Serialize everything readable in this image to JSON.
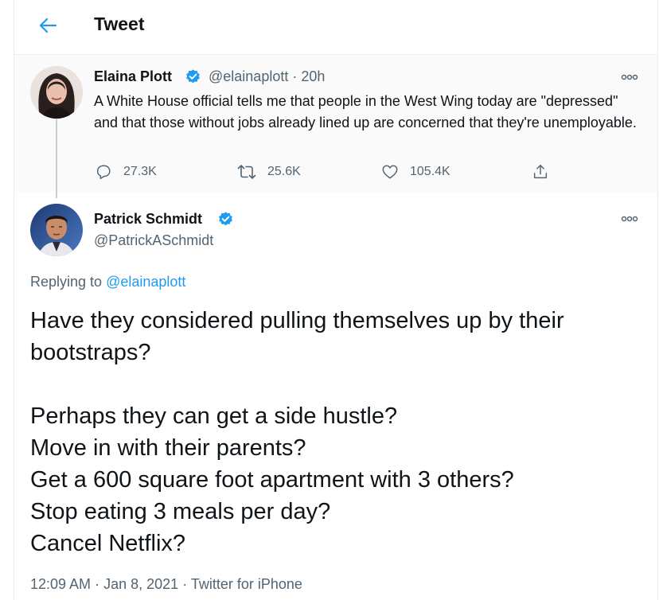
{
  "header": {
    "title": "Tweet"
  },
  "parent_tweet": {
    "name": "Elaina Plott",
    "handle": "@elainaplott",
    "time_sep": "·",
    "time": "20h",
    "text": "A White House official tells me that people in the West Wing today are \"depressed\" and that those without jobs already lined up are concerned that they're unemployable.",
    "actions": {
      "replies": "27.3K",
      "retweets": "25.6K",
      "likes": "105.4K"
    }
  },
  "main_tweet": {
    "name": "Patrick Schmidt",
    "handle": "@PatrickASchmidt",
    "replying_prefix": "Replying to",
    "replying_handle": "@elainaplott",
    "text": "Have they considered pulling themselves up by their\nbootstraps?\n\nPerhaps they can get a side hustle?\nMove in with their parents?\nGet a 600 square foot apartment with 3 others?\nStop eating 3 meals per day?\nCancel Netflix?",
    "time": "12:09 AM",
    "sep1": "·",
    "date": "Jan 8, 2021",
    "sep2": "·",
    "source": "Twitter for iPhone"
  },
  "colors": {
    "accent": "#1d9bf0",
    "secondary_text": "#536471",
    "border": "#ebeef0"
  },
  "icons": {
    "back": "arrow-left-icon",
    "verified": "verified-badge-icon",
    "more": "more-horizontal-icon",
    "reply": "reply-icon",
    "retweet": "retweet-icon",
    "like": "heart-icon",
    "share": "share-icon"
  }
}
